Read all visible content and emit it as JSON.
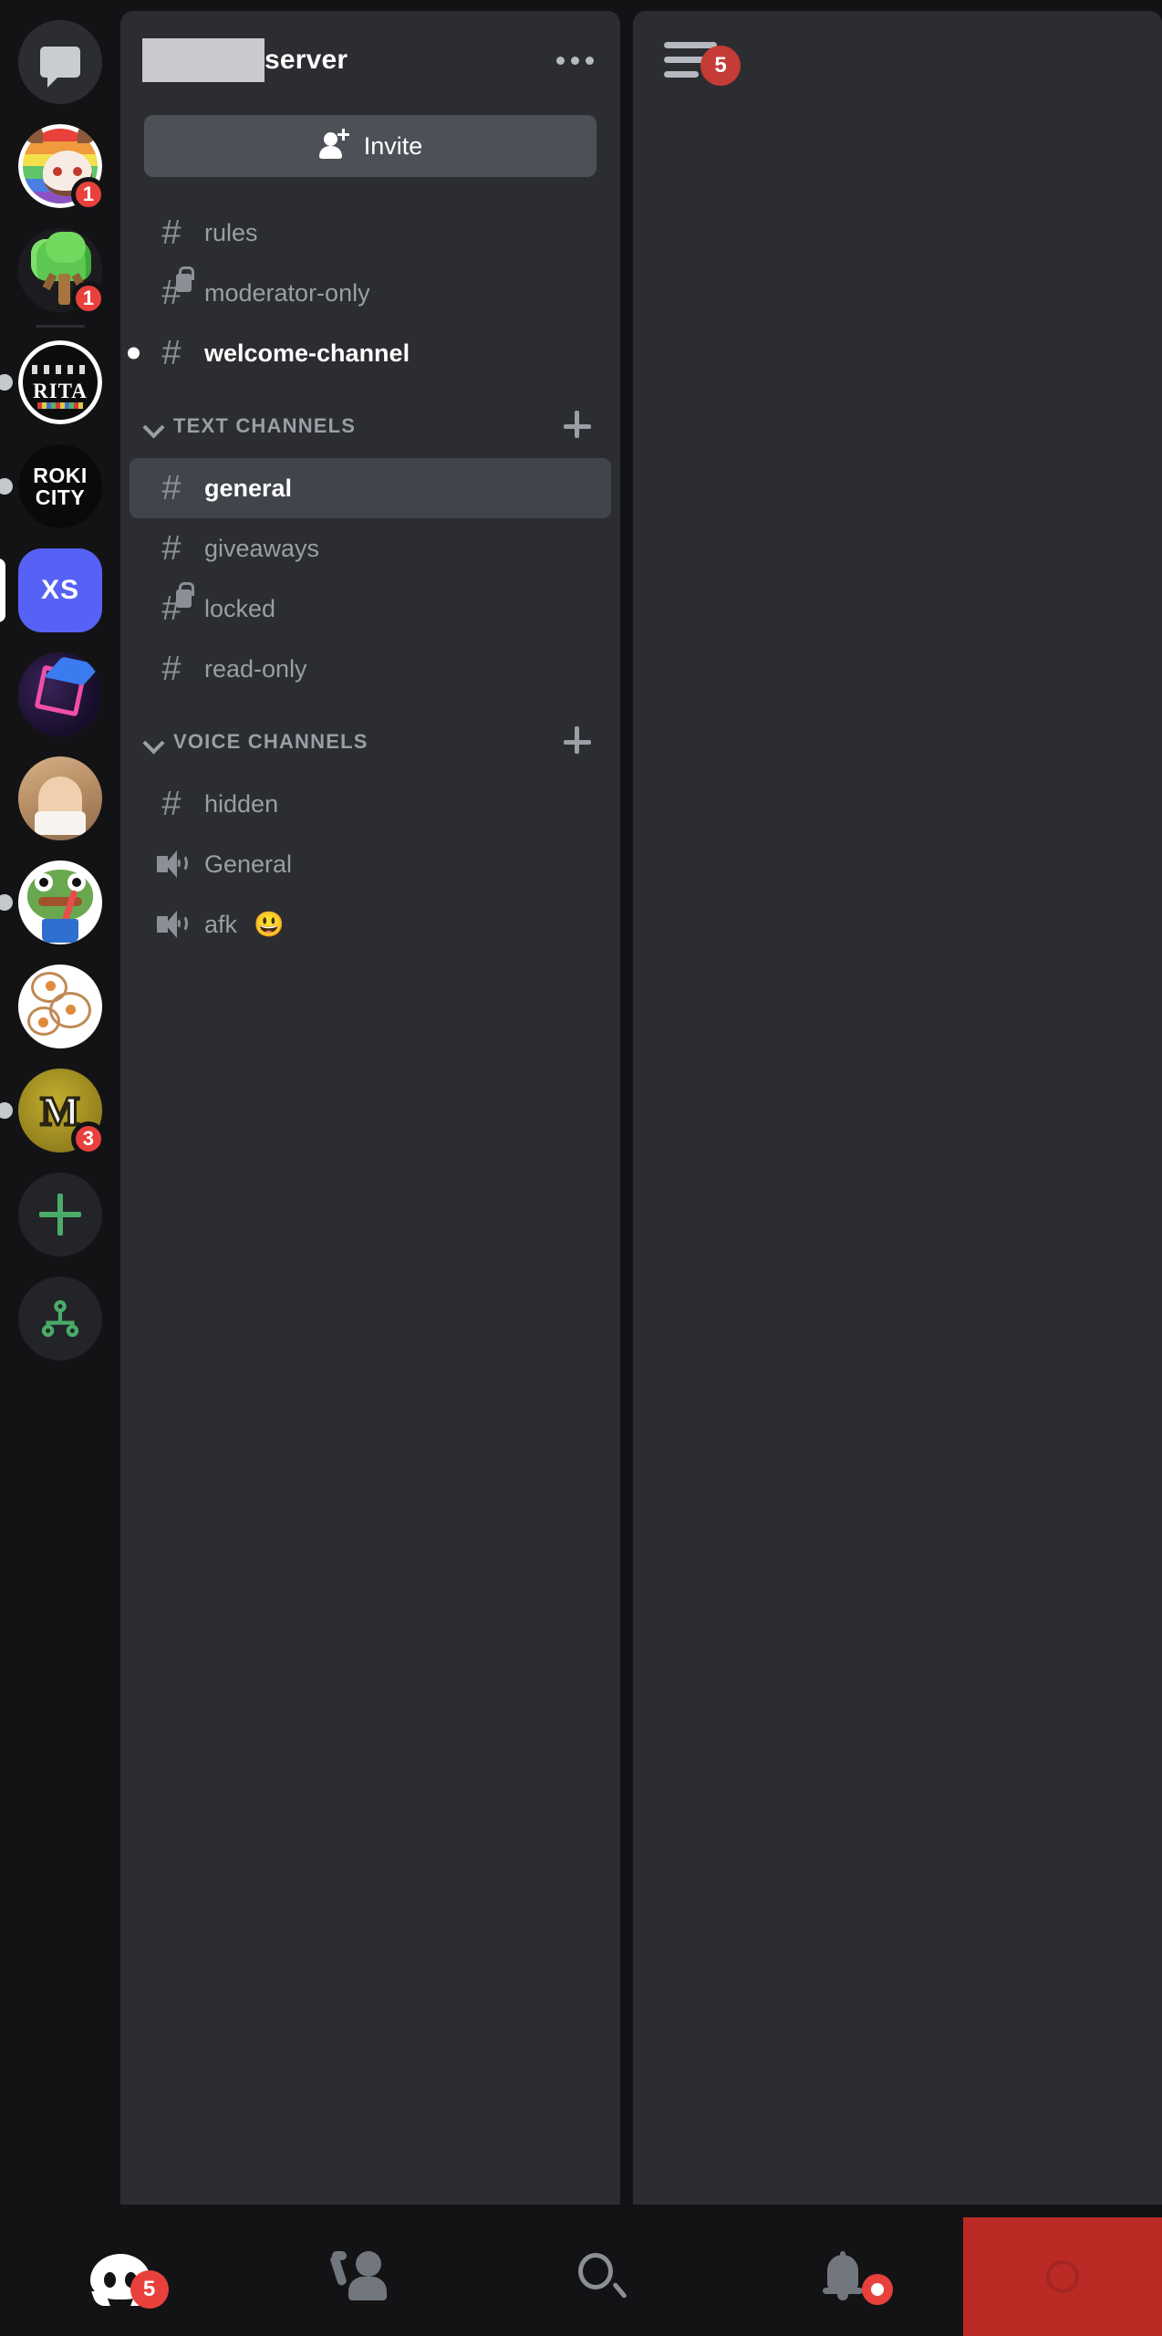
{
  "server_rail": {
    "items": [
      {
        "name": "direct-messages",
        "icon": "chat-bubble-icon",
        "label": "",
        "badge": null,
        "state": "none"
      },
      {
        "name": "server-red-panda",
        "icon": "server-avatar",
        "label": "",
        "badge": "1",
        "state": "none"
      },
      {
        "name": "server-tree",
        "icon": "server-avatar",
        "label": "",
        "badge": "1",
        "state": "none"
      },
      {
        "name": "server-rita",
        "icon": "server-avatar",
        "label": "RITA",
        "badge": null,
        "state": "unread"
      },
      {
        "name": "server-roki-city",
        "icon": "server-avatar",
        "label_line1": "ROKI",
        "label_line2": "CITY",
        "badge": null,
        "state": "unread"
      },
      {
        "name": "server-xs",
        "icon": "server-avatar",
        "label": "XS",
        "badge": null,
        "state": "selected"
      },
      {
        "name": "server-cube",
        "icon": "server-avatar",
        "label": "",
        "badge": null,
        "state": "none"
      },
      {
        "name": "server-sauna",
        "icon": "server-avatar",
        "label": "",
        "badge": null,
        "state": "none"
      },
      {
        "name": "server-pepe",
        "icon": "server-avatar",
        "label": "",
        "badge": null,
        "state": "unread"
      },
      {
        "name": "server-doodle",
        "icon": "server-avatar",
        "label": "",
        "badge": null,
        "state": "none"
      },
      {
        "name": "server-m",
        "icon": "server-avatar",
        "label": "M",
        "badge": "3",
        "state": "unread"
      }
    ],
    "add_server_label": "+",
    "explore_servers_label": "explore"
  },
  "channel_panel": {
    "server_name_suffix": "server",
    "server_name_redacted": true,
    "more_options_label": "•••",
    "invite": {
      "label": "Invite",
      "icon": "person-add-icon"
    },
    "top_channels": [
      {
        "name": "rules",
        "type": "text",
        "locked": false,
        "unread": false,
        "selected": false
      },
      {
        "name": "moderator-only",
        "type": "text",
        "locked": true,
        "unread": false,
        "selected": false
      },
      {
        "name": "welcome-channel",
        "type": "text",
        "locked": false,
        "unread": true,
        "selected": false
      }
    ],
    "groups": [
      {
        "label": "TEXT CHANNELS",
        "add_label": "+",
        "channels": [
          {
            "name": "general",
            "type": "text",
            "locked": false,
            "unread": false,
            "selected": true
          },
          {
            "name": "giveaways",
            "type": "text",
            "locked": false,
            "unread": false,
            "selected": false
          },
          {
            "name": "locked",
            "type": "text",
            "locked": true,
            "unread": false,
            "selected": false
          },
          {
            "name": "read-only",
            "type": "text",
            "locked": false,
            "unread": false,
            "selected": false
          }
        ]
      },
      {
        "label": "VOICE CHANNELS",
        "add_label": "+",
        "channels": [
          {
            "name": "hidden",
            "type": "text",
            "locked": false,
            "unread": false,
            "selected": false
          },
          {
            "name": "General",
            "type": "voice",
            "locked": false,
            "unread": false,
            "selected": false
          },
          {
            "name": "afk",
            "emoji": "😃",
            "type": "voice",
            "locked": false,
            "unread": false,
            "selected": false
          }
        ]
      }
    ]
  },
  "peek_panel": {
    "menu_icon": "hamburger-menu-icon",
    "badge": "5"
  },
  "bottom_nav": {
    "items": [
      {
        "name": "servers-tab",
        "icon": "discord-logo-icon",
        "badge": "5"
      },
      {
        "name": "mentions-tab",
        "icon": "mention-person-icon",
        "badge": null
      },
      {
        "name": "search-tab",
        "icon": "search-icon",
        "badge": null
      },
      {
        "name": "notifications-tab",
        "icon": "bell-icon",
        "badge": "dot"
      }
    ],
    "call_pane": {
      "name": "end-call-pane",
      "icon": "record-circle-icon"
    }
  },
  "colors": {
    "accent_red": "#e8413b",
    "panel_bg": "#2b2d31",
    "rail_bg": "#131316",
    "selected_row": "#40444b",
    "invite_btn": "#4e5058",
    "muted_text": "#9a9ea5",
    "call_pane_red": "#bc2a25",
    "brand_blurple": "#5662f6"
  }
}
